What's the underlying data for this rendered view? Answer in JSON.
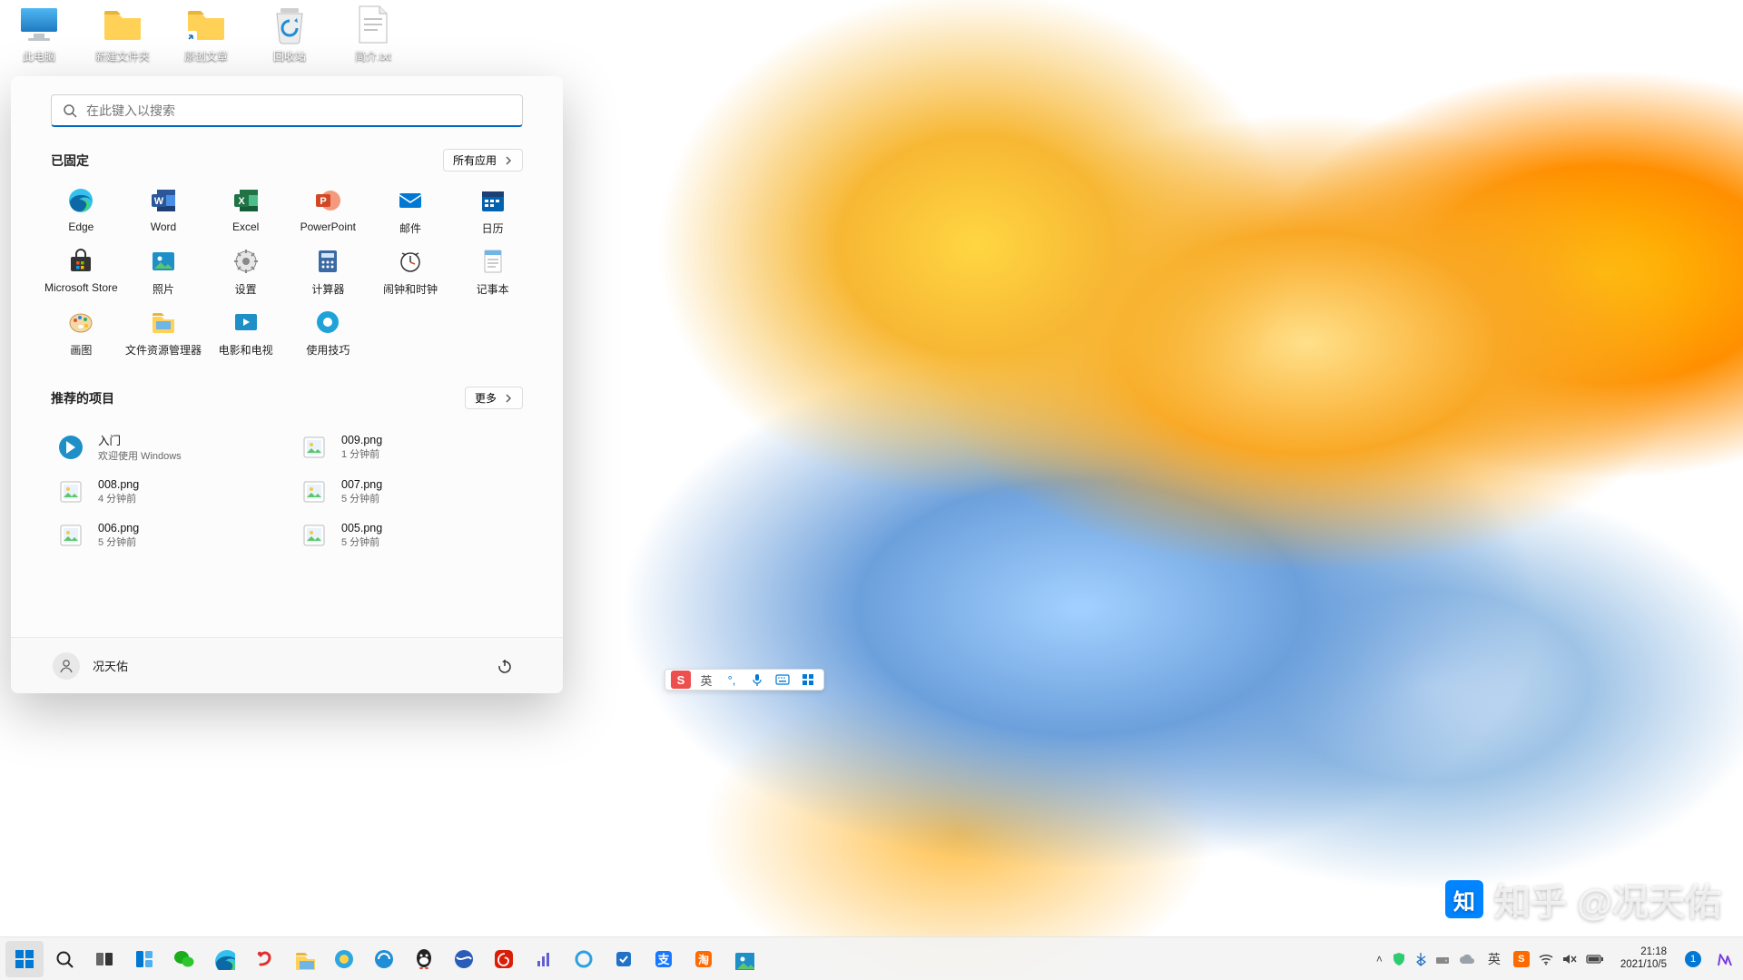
{
  "desktop": {
    "icons": [
      {
        "name": "this-pc",
        "label": "此电脑"
      },
      {
        "name": "new-folder",
        "label": "新建文件夹"
      },
      {
        "name": "original-articles",
        "label": "原创文章"
      },
      {
        "name": "recycle-bin",
        "label": "回收站"
      },
      {
        "name": "brief-txt",
        "label": "简介.txt"
      }
    ]
  },
  "start": {
    "search_placeholder": "在此键入以搜索",
    "pinned": {
      "title": "已固定",
      "all_apps": "所有应用",
      "apps": [
        {
          "name": "edge",
          "label": "Edge",
          "fg": "#fff",
          "bg": "#34A0E0"
        },
        {
          "name": "word",
          "label": "Word",
          "fg": "#fff",
          "bg": "#2B579A"
        },
        {
          "name": "excel",
          "label": "Excel",
          "fg": "#fff",
          "bg": "#217346"
        },
        {
          "name": "powerpoint",
          "label": "PowerPoint",
          "fg": "#fff",
          "bg": "#D24726"
        },
        {
          "name": "mail",
          "label": "邮件",
          "fg": "#fff",
          "bg": "#0078D4"
        },
        {
          "name": "calendar",
          "label": "日历",
          "fg": "#fff",
          "bg": "#0063B1"
        },
        {
          "name": "store",
          "label": "Microsoft Store",
          "fg": "#fff",
          "bg": "#333"
        },
        {
          "name": "photos",
          "label": "照片",
          "fg": "#fff",
          "bg": "#1E90C7"
        },
        {
          "name": "settings",
          "label": "设置",
          "fg": "#444",
          "bg": "#E6E6E6"
        },
        {
          "name": "calculator",
          "label": "计算器",
          "fg": "#fff",
          "bg": "#3C6AA4"
        },
        {
          "name": "alarms",
          "label": "闹钟和时钟",
          "fg": "#333",
          "bg": "#F0F0F0"
        },
        {
          "name": "notepad",
          "label": "记事本",
          "fg": "#333",
          "bg": "#EAEAEA"
        },
        {
          "name": "paint",
          "label": "画图",
          "fg": "#fff",
          "bg": "#FF5C8D"
        },
        {
          "name": "file-explorer",
          "label": "文件资源管理器",
          "fg": "#333",
          "bg": "#FFD249"
        },
        {
          "name": "movies-tv",
          "label": "电影和电视",
          "fg": "#fff",
          "bg": "#1E90C7"
        },
        {
          "name": "tips",
          "label": "使用技巧",
          "fg": "#fff",
          "bg": "#1FA2D8"
        }
      ]
    },
    "recommended": {
      "title": "推荐的项目",
      "more": "更多",
      "items": [
        {
          "title": "入门",
          "sub": "欢迎使用 Windows",
          "icon": "welcome"
        },
        {
          "title": "009.png",
          "sub": "1 分钟前",
          "icon": "image"
        },
        {
          "title": "008.png",
          "sub": "4 分钟前",
          "icon": "image"
        },
        {
          "title": "007.png",
          "sub": "5 分钟前",
          "icon": "image"
        },
        {
          "title": "006.png",
          "sub": "5 分钟前",
          "icon": "image"
        },
        {
          "title": "005.png",
          "sub": "5 分钟前",
          "icon": "image"
        }
      ]
    },
    "user_name": "况天佑"
  },
  "ime": {
    "s": "S",
    "lang": "英",
    "icons": [
      "mic",
      "keyboard",
      "grid"
    ]
  },
  "watermark": "@况天佑",
  "taskbar": {
    "items": [
      {
        "name": "start",
        "color": "#0078D4"
      },
      {
        "name": "search",
        "color": "#222"
      },
      {
        "name": "task-view",
        "color": "#222"
      },
      {
        "name": "widgets",
        "color": "#0078D4"
      },
      {
        "name": "wechat",
        "color": "#1AAD19"
      },
      {
        "name": "edge",
        "color": "#2A8CD2"
      },
      {
        "name": "sogou",
        "color": "#E02E2E"
      },
      {
        "name": "file-explorer",
        "color": "#FFB02E"
      },
      {
        "name": "browser-360",
        "color": "#2EA6E0"
      },
      {
        "name": "tencent-browser",
        "color": "#1E8FD6"
      },
      {
        "name": "qq",
        "color": "#222"
      },
      {
        "name": "browser-ball",
        "color": "#2A5DBA"
      },
      {
        "name": "netease-music",
        "color": "#D81E06"
      },
      {
        "name": "monitor",
        "color": "#5F5FD0"
      },
      {
        "name": "cortana",
        "color": "#2FA0E0"
      },
      {
        "name": "todo",
        "color": "#2172C6"
      },
      {
        "name": "alipay",
        "color": "#1677FF"
      },
      {
        "name": "taobao",
        "color": "#FF6A00"
      },
      {
        "name": "photos",
        "color": "#19A1DA"
      }
    ],
    "tray": {
      "chevron": "^",
      "shield": true,
      "bluetooth": true,
      "drive": true,
      "cloud": true,
      "ime_lang": "英",
      "sogou_s": "S",
      "wifi": true,
      "volume": "muted",
      "battery": true
    },
    "clock": {
      "time": "21:18",
      "date": "2021/10/5"
    },
    "notif_count": "1"
  }
}
